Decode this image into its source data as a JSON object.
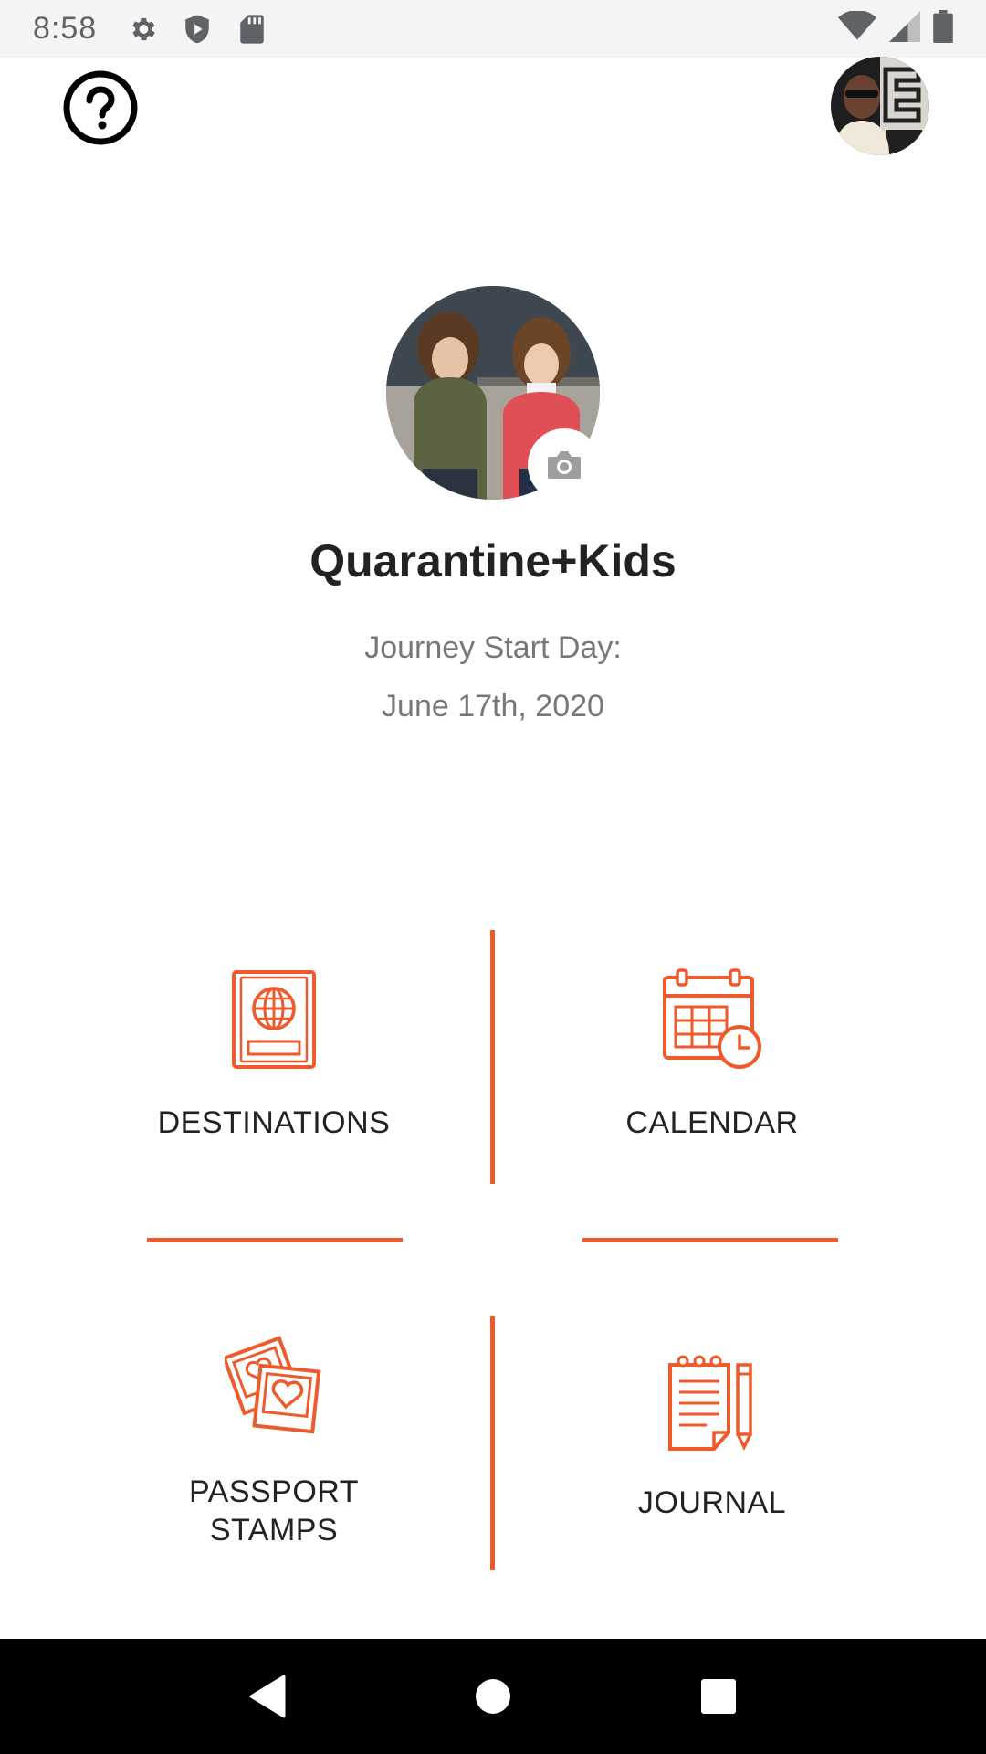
{
  "status_bar": {
    "time": "8:58",
    "icons_left": [
      "gear-icon",
      "shield-icon",
      "sd-card-icon"
    ],
    "icons_right": [
      "wifi-icon",
      "signal-icon",
      "battery-icon"
    ]
  },
  "header": {
    "help_icon": "question-circle-icon",
    "avatar": "user-avatar"
  },
  "journey": {
    "title": "Quarantine+Kids",
    "start_label": "Journey Start Day:",
    "start_date": "June 17th, 2020",
    "photo_edit_icon": "camera-icon"
  },
  "menu": {
    "destinations": "DESTINATIONS",
    "calendar": "CALENDAR",
    "passport_stamps": "PASSPORT\nSTAMPS",
    "journal": "JOURNAL"
  },
  "colors": {
    "accent": "#ef5a2c",
    "title": "#222222",
    "subtitle": "#777777"
  },
  "nav_bar": {
    "icons": [
      "back-triangle-icon",
      "home-circle-icon",
      "recents-square-icon"
    ]
  }
}
